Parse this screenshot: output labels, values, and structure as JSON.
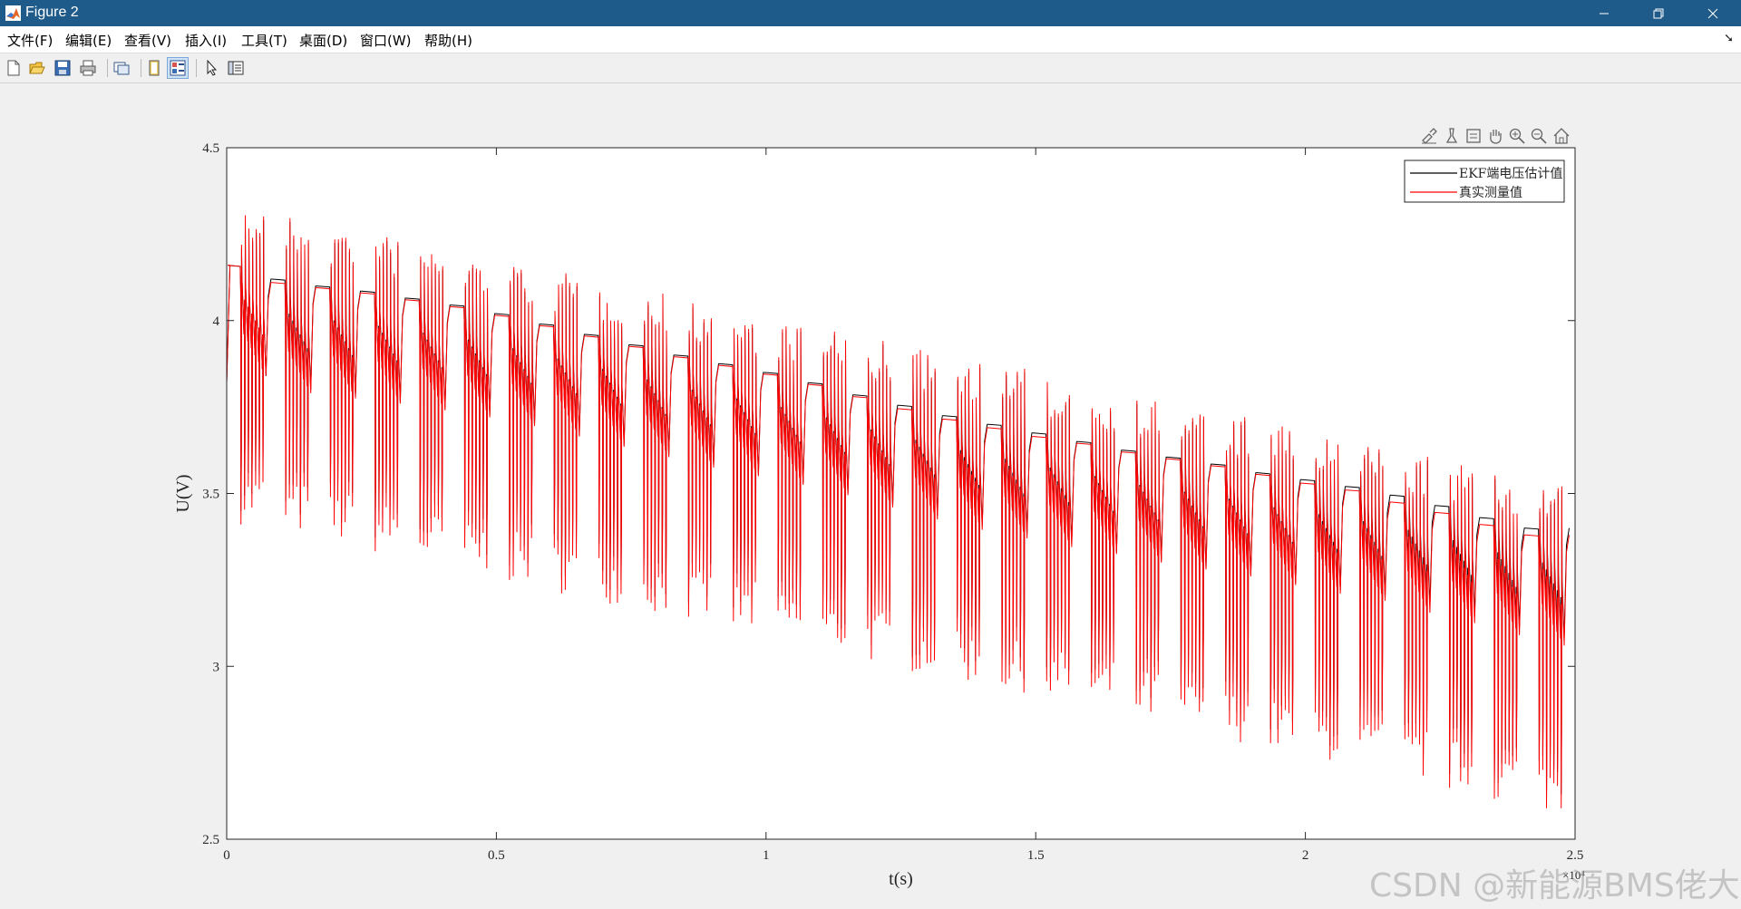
{
  "window": {
    "title": "Figure 2",
    "titlebar_color": "#1f5b8a"
  },
  "menu": {
    "items": [
      "文件(F)",
      "编辑(E)",
      "查看(V)",
      "插入(I)",
      "工具(T)",
      "桌面(D)",
      "窗口(W)",
      "帮助(H)"
    ]
  },
  "toolbar": {
    "icons": [
      "new-figure-icon",
      "open-file-icon",
      "save-icon",
      "print-icon",
      "link-plot-icon",
      "hide-plot-tools-icon",
      "show-plot-tools-icon",
      "edit-plot-arrow-icon",
      "property-inspector-icon"
    ]
  },
  "axes_toolbar": {
    "icons": [
      "brush-icon",
      "data-tip-icon",
      "legend-box-icon",
      "pan-hand-icon",
      "zoom-in-icon",
      "zoom-out-icon",
      "restore-view-home-icon"
    ]
  },
  "colors": {
    "estimate": "#000000",
    "measured": "#ff0000",
    "axes_bg": "#ffffff",
    "figure_bg": "#f0f0f0"
  },
  "chart_data": {
    "type": "line",
    "xlabel": "t(s)",
    "ylabel": "U(V)",
    "xlim": [
      0,
      25000
    ],
    "ylim": [
      2.5,
      4.5
    ],
    "x_exponent_label": "×10⁴",
    "xticks": [
      0,
      0.5,
      1,
      1.5,
      2,
      2.5
    ],
    "yticks": [
      2.5,
      3,
      3.5,
      4,
      4.5
    ],
    "xtick_labels": [
      "0",
      "0.5",
      "1",
      "1.5",
      "2",
      "2.5"
    ],
    "ytick_labels": [
      "2.5",
      "3",
      "3.5",
      "4",
      "4.5"
    ],
    "legend": {
      "location": "top-right",
      "entries": [
        "EKF端电压估计值",
        "真实测量值"
      ]
    },
    "grid": false,
    "series": [
      {
        "name": "EKF端电压估计值",
        "color": "#000000",
        "rest_levels": [
          4.16,
          4.12,
          4.1,
          4.085,
          4.065,
          4.045,
          4.02,
          3.99,
          3.96,
          3.93,
          3.9,
          3.875,
          3.85,
          3.82,
          3.785,
          3.755,
          3.725,
          3.7,
          3.675,
          3.65,
          3.625,
          3.605,
          3.585,
          3.56,
          3.54,
          3.52,
          3.495,
          3.465,
          3.43,
          3.4
        ]
      },
      {
        "name": "真实测量值",
        "color": "#ff0000",
        "rest_levels": [
          4.16,
          4.11,
          4.095,
          4.08,
          4.06,
          4.04,
          4.015,
          3.985,
          3.955,
          3.925,
          3.895,
          3.87,
          3.845,
          3.815,
          3.78,
          3.745,
          3.715,
          3.69,
          3.665,
          3.645,
          3.62,
          3.6,
          3.58,
          3.555,
          3.53,
          3.51,
          3.475,
          3.445,
          3.41,
          3.38
        ]
      }
    ],
    "cycle_period_s": 830,
    "pulse_min_voltage_start": 3.45,
    "pulse_min_voltage_end": 2.62,
    "pulse_peak_voltage_start": 4.32,
    "pulse_peak_voltage_end": 3.52
  },
  "watermark": "CSDN @新能源BMS佬大"
}
